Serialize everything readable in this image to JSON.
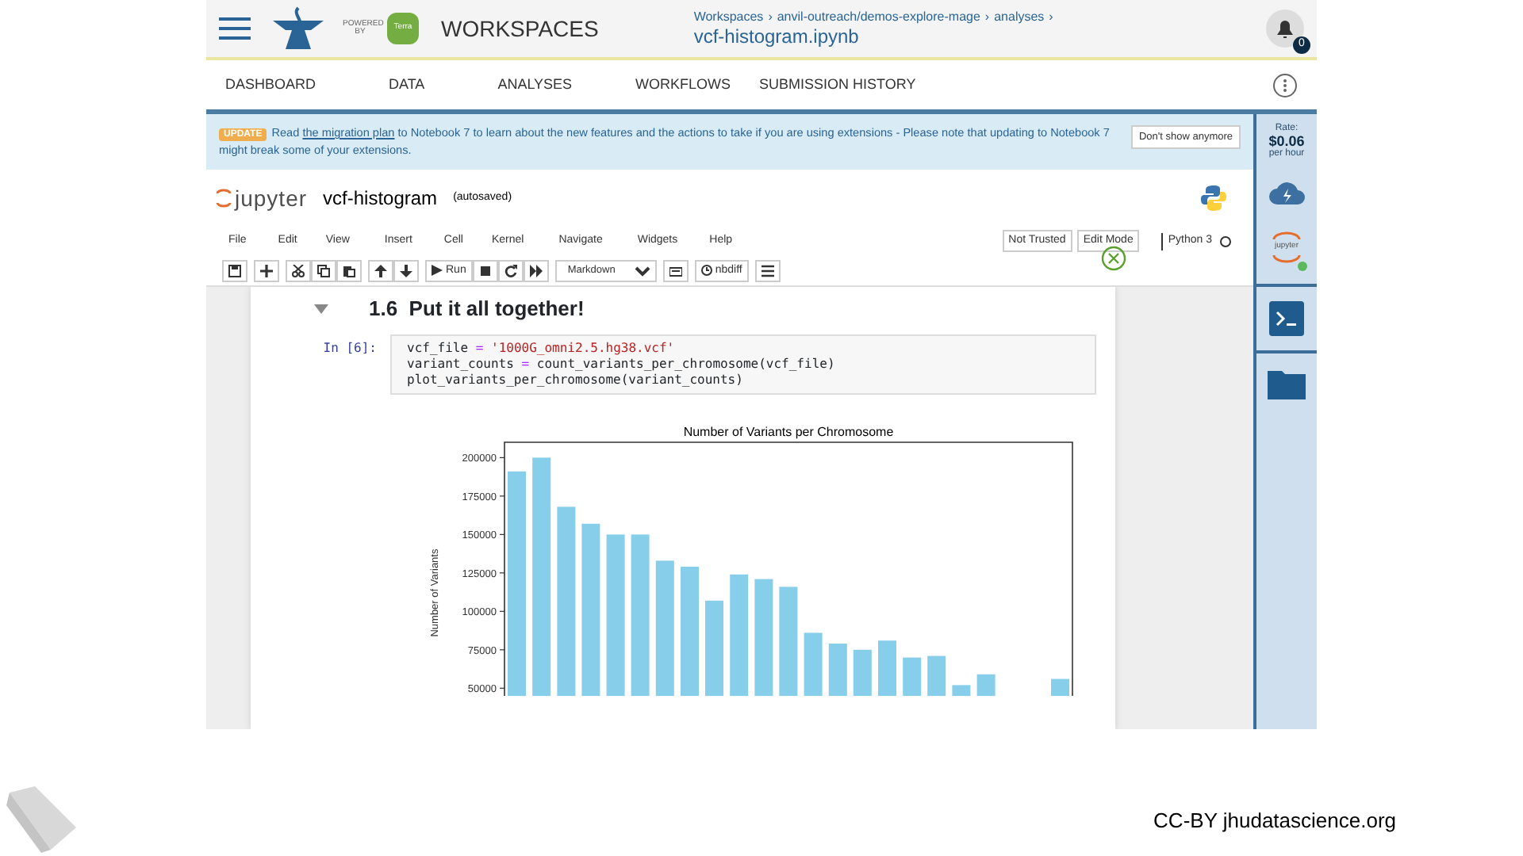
{
  "header": {
    "powered_by": "POWERED BY",
    "terra_badge": "Terra",
    "title": "WORKSPACES",
    "breadcrumbs": [
      "Workspaces",
      "anvil-outreach/demos-explore-mage",
      "analyses"
    ],
    "separator": "›",
    "notebook_name": "vcf-histogram.ipynb",
    "notification_count": "0"
  },
  "nav_tabs": [
    {
      "label": "DASHBOARD",
      "selected": false
    },
    {
      "label": "DATA",
      "selected": false
    },
    {
      "label": "ANALYSES",
      "selected": false
    },
    {
      "label": "WORKFLOWS",
      "selected": false
    },
    {
      "label": "SUBMISSION HISTORY",
      "selected": false
    }
  ],
  "banner": {
    "badge": "UPDATE",
    "text_before": "Read",
    "link": "the migration plan",
    "text_after": "to Notebook 7 to learn about the new features and the actions to take if you are using extensions - Please note that updating to Notebook 7 might break some of your extensions.",
    "button": "Don't show anymore"
  },
  "sidebar": {
    "rate_label": "Rate:",
    "rate_value": "$0.06",
    "rate_unit": "per hour",
    "jupyter_label": "jupyter"
  },
  "jupyter": {
    "logo": "jupyter",
    "notebook_title": "vcf-histogram",
    "save_status": "(autosaved)",
    "menu": [
      "File",
      "Edit",
      "View",
      "Insert",
      "Cell",
      "Kernel",
      "Navigate",
      "Widgets",
      "Help"
    ],
    "trust": "Not Trusted",
    "mode": "Edit Mode",
    "kernel": "Python 3",
    "toolbar": {
      "run": "Run",
      "cell_type": "Markdown",
      "nbdiff": "nbdiff"
    }
  },
  "notebook": {
    "heading": "1.6  Put it all together!",
    "prompt": "In [6]:",
    "code": [
      [
        {
          "text": "vcf_file",
          "kind": "plain"
        },
        {
          "text": "=",
          "kind": "op"
        },
        {
          "text": "'1000G_omni2.5.hg38.vcf'",
          "kind": "str"
        }
      ],
      [
        {
          "text": "variant_counts",
          "kind": "plain"
        },
        {
          "text": "=",
          "kind": "op"
        },
        {
          "text": "count_variants_per_chromosome(vcf_file)",
          "kind": "plain"
        }
      ],
      [
        {
          "text": "plot_variants_per_chromosome(variant_counts)",
          "kind": "plain"
        }
      ]
    ],
    "chart_data": {
      "type": "bar",
      "title": "Number of Variants per Chromosome",
      "ylabel": "Number of Variants",
      "categories": [
        null,
        null,
        null,
        null,
        null,
        null,
        null,
        null,
        null,
        null,
        null,
        null,
        null,
        null,
        null,
        null,
        null,
        null,
        null,
        null,
        null,
        null,
        null
      ],
      "series": [
        {
          "color": "#87ceeb",
          "values": [
            191000,
            200000,
            168000,
            157000,
            150000,
            150000,
            133000,
            129000,
            107000,
            124000,
            121000,
            116000,
            86000,
            79000,
            75000,
            81000,
            70000,
            71000,
            52000,
            59000,
            null,
            null,
            56000
          ]
        }
      ],
      "ylim": [
        45000,
        210000
      ],
      "yticks": [
        50000,
        75000,
        100000,
        125000,
        150000,
        175000,
        200000
      ]
    }
  },
  "footer": {
    "license": "CC-BY  jhudatascience.org"
  }
}
